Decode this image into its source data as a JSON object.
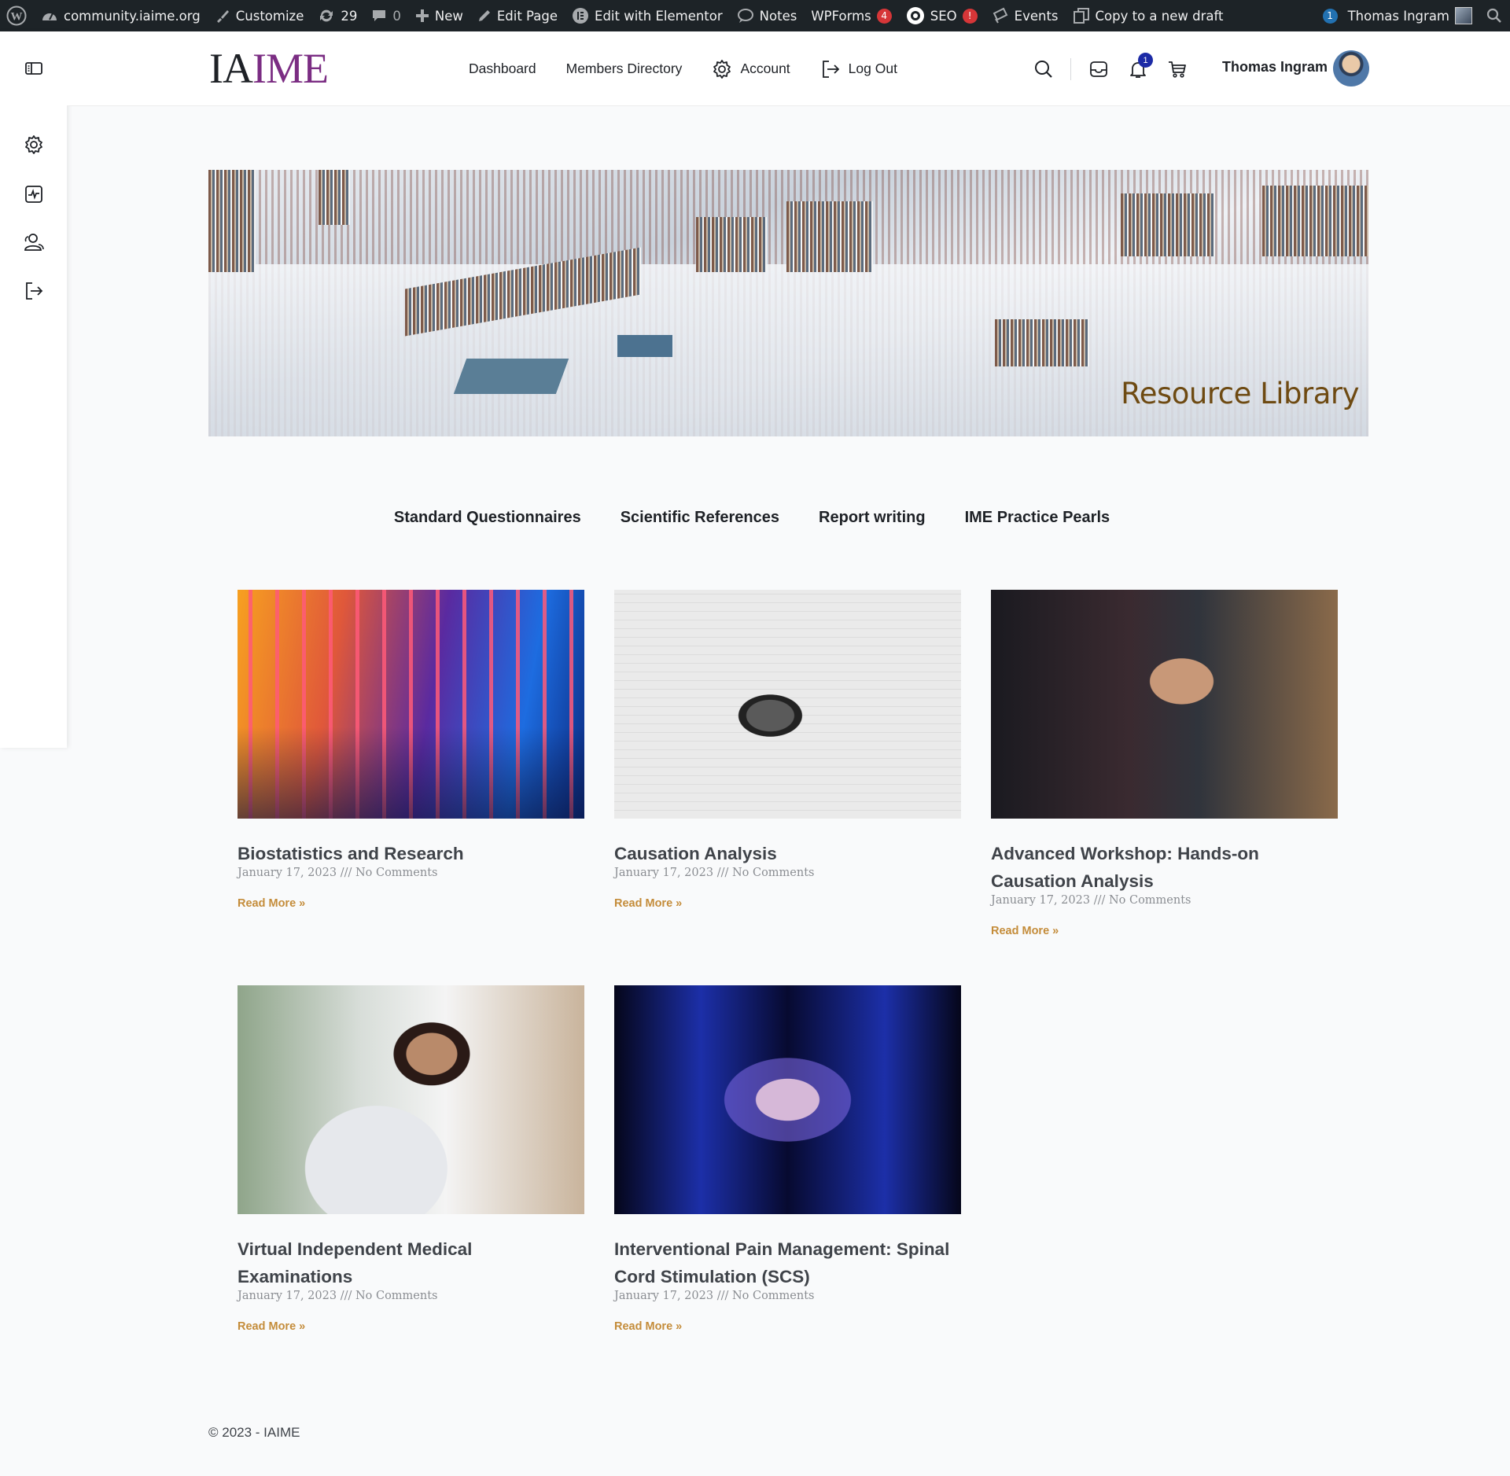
{
  "admin_bar": {
    "site": "community.iaime.org",
    "customize": "Customize",
    "updates_count": "29",
    "comments_count": "0",
    "new": "New",
    "edit_page": "Edit Page",
    "edit_elementor": "Edit with Elementor",
    "notes": "Notes",
    "wpforms": "WPForms",
    "wpforms_badge": "4",
    "seo": "SEO",
    "seo_badge": "!",
    "events": "Events",
    "copy_draft": "Copy to a new draft",
    "user_badge": "1",
    "user": "Thomas Ingram"
  },
  "header": {
    "logo_part1": "IA",
    "logo_part2": "IME",
    "nav": [
      "Dashboard",
      "Members Directory",
      "Account",
      "Log Out"
    ],
    "notification_count": "1",
    "user_name": "Thomas Ingram"
  },
  "hero": {
    "title": "Resource Library"
  },
  "tabs": [
    "Standard Questionnaires",
    "Scientific References",
    "Report writing",
    "IME Practice Pearls"
  ],
  "posts": [
    {
      "title": "Biostatistics and Research",
      "meta": "January 17, 2023 /// No Comments",
      "more": "Read More »"
    },
    {
      "title": "Causation Analysis",
      "meta": "January 17, 2023 /// No Comments",
      "more": "Read More »"
    },
    {
      "title": "Advanced Workshop: Hands-on Causation Analysis",
      "meta": "January 17, 2023 /// No Comments",
      "more": "Read More »"
    },
    {
      "title": "Virtual Independent Medical Examinations",
      "meta": "January 17, 2023 /// No Comments",
      "more": "Read More »"
    },
    {
      "title": "Interventional Pain Management: Spinal Cord Stimulation (SCS)",
      "meta": "January 17, 2023 /// No Comments",
      "more": "Read More »"
    }
  ],
  "footer": {
    "text": "© 2023 - IAIME"
  },
  "colors": {
    "logo_accent": "#7b2d83",
    "hero_title": "#6e4a12",
    "read_more": "#c48c3a",
    "admin_bar": "#1d2327",
    "badge_red": "#d63638"
  }
}
